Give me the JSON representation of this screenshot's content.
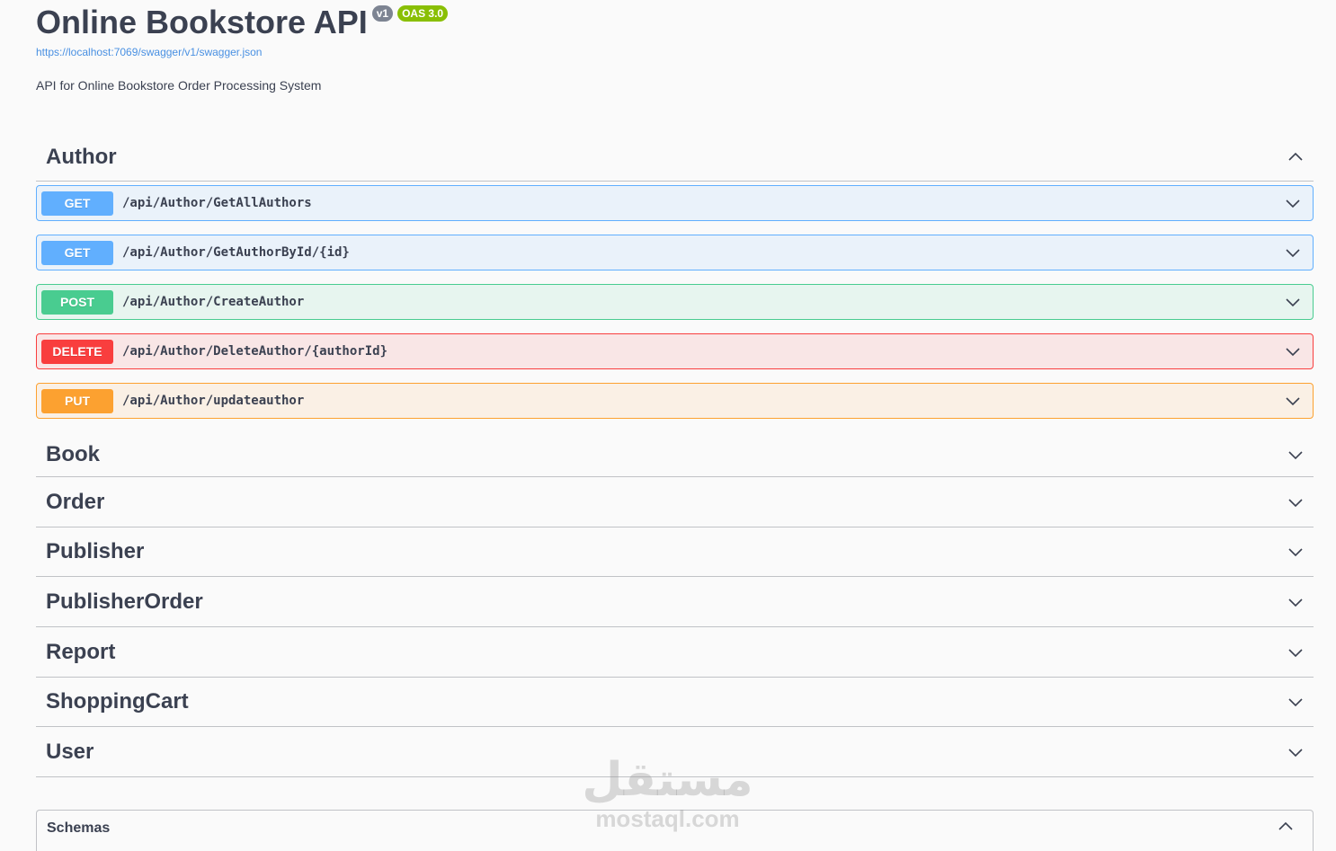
{
  "info": {
    "title": "Online Bookstore API",
    "version_badge": "v1",
    "oas_badge": "OAS 3.0",
    "spec_url": "https://localhost:7069/swagger/v1/swagger.json",
    "description": "API for Online Bookstore Order Processing System"
  },
  "tags": {
    "author": {
      "name": "Author",
      "expanded": true,
      "operations": [
        {
          "method": "GET",
          "path": "/api/Author/GetAllAuthors"
        },
        {
          "method": "GET",
          "path": "/api/Author/GetAuthorById/{id}"
        },
        {
          "method": "POST",
          "path": "/api/Author/CreateAuthor"
        },
        {
          "method": "DELETE",
          "path": "/api/Author/DeleteAuthor/{authorId}"
        },
        {
          "method": "PUT",
          "path": "/api/Author/updateauthor"
        }
      ]
    },
    "collapsed": [
      {
        "name": "Book"
      },
      {
        "name": "Order"
      },
      {
        "name": "Publisher"
      },
      {
        "name": "PublisherOrder"
      },
      {
        "name": "Report"
      },
      {
        "name": "ShoppingCart"
      },
      {
        "name": "User"
      }
    ]
  },
  "schemas": {
    "title": "Schemas"
  },
  "watermark": {
    "arabic": "مستقل",
    "latin": "mostaql.com"
  },
  "colors": {
    "get": "#61affe",
    "post": "#49cc90",
    "delete": "#f93e3e",
    "put": "#fca130",
    "text": "#3b4151",
    "link": "#4990e2",
    "oas_badge": "#89bf04",
    "version_badge": "#7d8492"
  },
  "icons": {
    "expanded_chevron": "chevron-up-icon",
    "collapsed_chevron": "chevron-down-icon"
  }
}
